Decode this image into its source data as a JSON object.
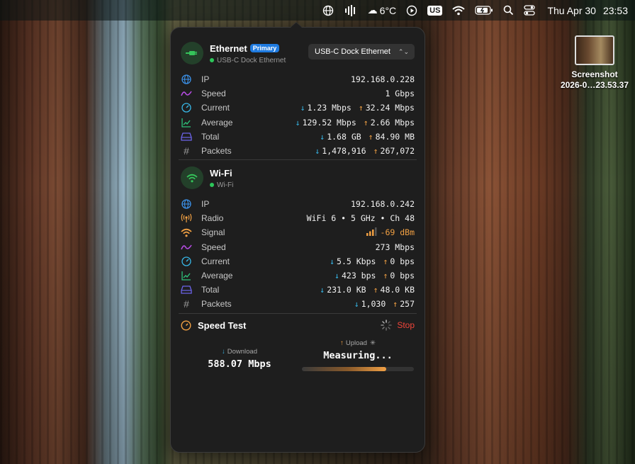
{
  "menubar": {
    "weather": "6°C",
    "input_source": "US",
    "date": "Thu Apr 30",
    "time": "23:53"
  },
  "desktop": {
    "file_name_line1": "Screenshot",
    "file_name_line2": "2026-0…23.53.37"
  },
  "ethernet": {
    "name": "Ethernet",
    "badge": "Primary",
    "subtitle": "USB-C Dock Ethernet",
    "dropdown": "USB-C Dock Ethernet",
    "rows": {
      "ip": {
        "label": "IP",
        "value": "192.168.0.228"
      },
      "speed": {
        "label": "Speed",
        "value": "1 Gbps"
      },
      "current": {
        "label": "Current",
        "down": "1.23 Mbps",
        "up": "32.24 Mbps"
      },
      "average": {
        "label": "Average",
        "down": "129.52 Mbps",
        "up": "2.66 Mbps"
      },
      "total": {
        "label": "Total",
        "down": "1.68 GB",
        "up": "84.90 MB"
      },
      "packets": {
        "label": "Packets",
        "down": "1,478,916",
        "up": "267,072"
      }
    }
  },
  "wifi": {
    "name": "Wi-Fi",
    "subtitle": "Wi-Fi",
    "rows": {
      "ip": {
        "label": "IP",
        "value": "192.168.0.242"
      },
      "radio": {
        "label": "Radio",
        "value": "WiFi 6 • 5 GHz • Ch 48"
      },
      "signal": {
        "label": "Signal",
        "value": "-69 dBm"
      },
      "speed": {
        "label": "Speed",
        "value": "273 Mbps"
      },
      "current": {
        "label": "Current",
        "down": "5.5 Kbps",
        "up": "0 bps"
      },
      "average": {
        "label": "Average",
        "down": "423 bps",
        "up": "0 bps"
      },
      "total": {
        "label": "Total",
        "down": "231.0 KB",
        "up": "48.0 KB"
      },
      "packets": {
        "label": "Packets",
        "down": "1,030",
        "up": "257"
      }
    }
  },
  "speed_test": {
    "title": "Speed Test",
    "stop_label": "Stop",
    "download_caption": "Download",
    "download_value": "588.07 Mbps",
    "upload_caption": "Upload",
    "upload_value": "Measuring...",
    "upload_progress": 0.75
  },
  "colors": {
    "accent_down": "#37b6e6",
    "accent_up": "#f1a043",
    "stop": "#f0453a",
    "primary_badge": "#1f7be0"
  }
}
